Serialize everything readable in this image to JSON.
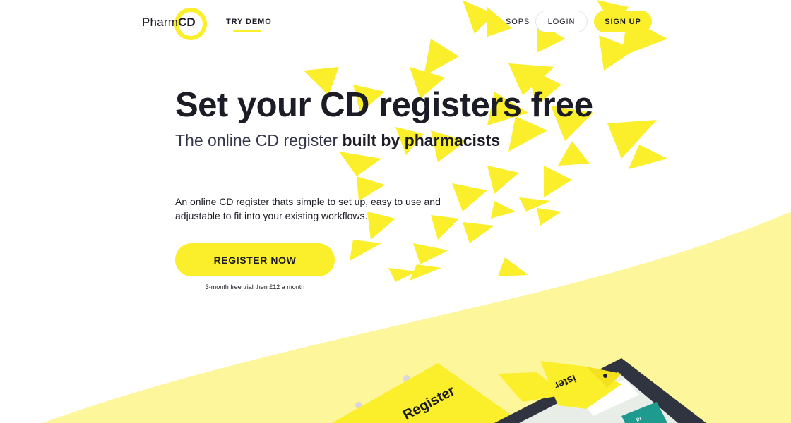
{
  "header": {
    "logo_text": "Pharm",
    "logo_strong": "CD",
    "nav_try_demo": "TRY DEMO",
    "nav_sops": "SOPS",
    "login_label": "LOGIN",
    "signup_label": "SIGN UP"
  },
  "hero": {
    "title": "Set your CD registers free",
    "subtitle_plain": "The online CD register ",
    "subtitle_bold": "built by pharmacists",
    "description": "An online CD register thats simple to set up, easy to use and adjustable to fit into your existing workflows.",
    "cta_label": "REGISTER NOW",
    "trial_note": "3-month free trial then £12 a month"
  },
  "illustration": {
    "book_label": "Register",
    "bird_label": "ister",
    "badge_label": "IN"
  },
  "icons": {
    "logo_ring": "ring-icon"
  },
  "colors": {
    "accent": "#fbee2a",
    "accent_light": "#fdf69a",
    "text": "#1c1c26",
    "tablet": "#2f3440",
    "screen_teal": "#1e9a8e"
  }
}
